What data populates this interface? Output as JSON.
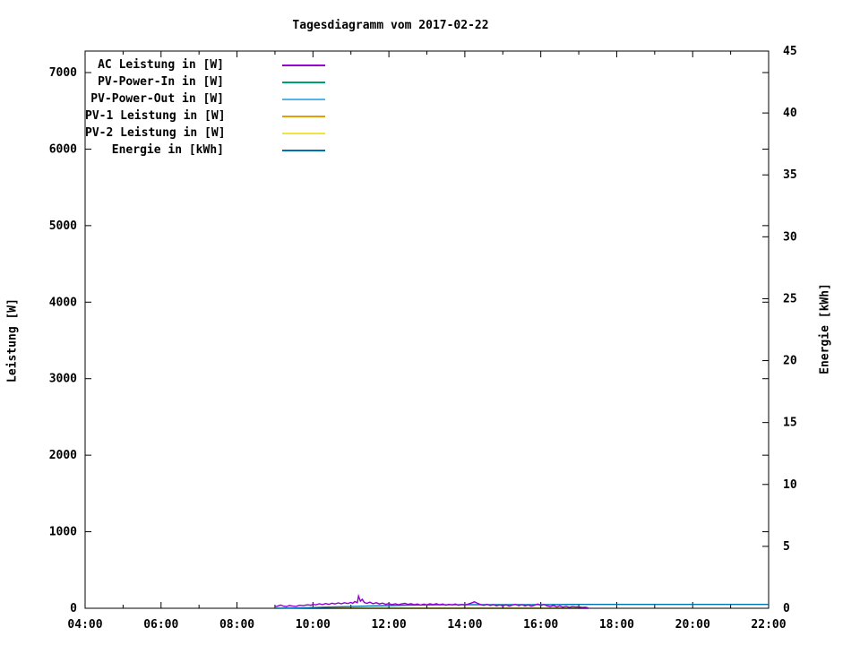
{
  "chart_data": {
    "type": "line",
    "title": "Tagesdiagramm vom 2017-02-22",
    "ylabel_left": "Leistung [W]",
    "ylabel_right": "Energie [kWh]",
    "background_color": "#ffffff",
    "axis_color": "#000000",
    "grid": "off",
    "legend_position": "top-left-inside",
    "x_axis": {
      "unit": "time-of-day",
      "start_hour": 4,
      "end_hour": 22,
      "major_tick_labels": [
        "04:00",
        "06:00",
        "08:00",
        "10:00",
        "12:00",
        "14:00",
        "16:00",
        "18:00",
        "20:00",
        "22:00"
      ],
      "major_tick_hours": [
        4,
        6,
        8,
        10,
        12,
        14,
        16,
        18,
        20,
        22
      ],
      "minor_tick_hours": [
        5,
        7,
        9,
        11,
        13,
        15,
        17,
        19,
        21
      ]
    },
    "y_left": {
      "label": "Leistung [W]",
      "min": 0,
      "max": 7280,
      "tick_values": [
        0,
        1000,
        2000,
        3000,
        4000,
        5000,
        6000,
        7000
      ]
    },
    "y_right": {
      "label": "Energie [kWh]",
      "min": 0,
      "max": 45,
      "tick_values": [
        0,
        5,
        10,
        15,
        20,
        25,
        30,
        35,
        40,
        45
      ]
    },
    "series": [
      {
        "name": "AC Leistung in [W]",
        "color": "#9400d3",
        "axis": "left",
        "points": [
          [
            9.0,
            18
          ],
          [
            9.08,
            30
          ],
          [
            9.15,
            42
          ],
          [
            9.22,
            28
          ],
          [
            9.3,
            22
          ],
          [
            9.38,
            36
          ],
          [
            9.45,
            30
          ],
          [
            9.55,
            24
          ],
          [
            9.65,
            40
          ],
          [
            9.75,
            34
          ],
          [
            9.85,
            46
          ],
          [
            9.95,
            40
          ],
          [
            10.0,
            52
          ],
          [
            10.08,
            44
          ],
          [
            10.17,
            58
          ],
          [
            10.25,
            48
          ],
          [
            10.33,
            62
          ],
          [
            10.42,
            52
          ],
          [
            10.5,
            66
          ],
          [
            10.58,
            56
          ],
          [
            10.67,
            70
          ],
          [
            10.75,
            58
          ],
          [
            10.83,
            72
          ],
          [
            10.92,
            62
          ],
          [
            11.0,
            76
          ],
          [
            11.05,
            64
          ],
          [
            11.1,
            88
          ],
          [
            11.17,
            72
          ],
          [
            11.2,
            160
          ],
          [
            11.25,
            92
          ],
          [
            11.3,
            118
          ],
          [
            11.35,
            76
          ],
          [
            11.42,
            64
          ],
          [
            11.5,
            80
          ],
          [
            11.58,
            60
          ],
          [
            11.67,
            72
          ],
          [
            11.75,
            56
          ],
          [
            11.83,
            68
          ],
          [
            11.92,
            52
          ],
          [
            12.0,
            62
          ],
          [
            12.08,
            48
          ],
          [
            12.17,
            58
          ],
          [
            12.25,
            46
          ],
          [
            12.33,
            56
          ],
          [
            12.42,
            64
          ],
          [
            12.5,
            50
          ],
          [
            12.58,
            60
          ],
          [
            12.67,
            46
          ],
          [
            12.75,
            56
          ],
          [
            12.83,
            42
          ],
          [
            12.92,
            54
          ],
          [
            13.0,
            44
          ],
          [
            13.08,
            58
          ],
          [
            13.17,
            48
          ],
          [
            13.25,
            60
          ],
          [
            13.33,
            46
          ],
          [
            13.42,
            56
          ],
          [
            13.5,
            40
          ],
          [
            13.58,
            52
          ],
          [
            13.67,
            44
          ],
          [
            13.75,
            56
          ],
          [
            13.83,
            40
          ],
          [
            13.92,
            50
          ],
          [
            14.0,
            42
          ],
          [
            14.08,
            54
          ],
          [
            14.17,
            68
          ],
          [
            14.25,
            84
          ],
          [
            14.33,
            66
          ],
          [
            14.42,
            48
          ],
          [
            14.5,
            38
          ],
          [
            14.58,
            52
          ],
          [
            14.67,
            36
          ],
          [
            14.75,
            48
          ],
          [
            14.83,
            32
          ],
          [
            14.92,
            44
          ],
          [
            15.0,
            30
          ],
          [
            15.08,
            46
          ],
          [
            15.17,
            28
          ],
          [
            15.25,
            42
          ],
          [
            15.33,
            52
          ],
          [
            15.42,
            34
          ],
          [
            15.5,
            48
          ],
          [
            15.58,
            30
          ],
          [
            15.67,
            44
          ],
          [
            15.75,
            26
          ],
          [
            15.83,
            40
          ],
          [
            15.92,
            56
          ],
          [
            16.0,
            36
          ],
          [
            16.08,
            50
          ],
          [
            16.17,
            32
          ],
          [
            16.25,
            22
          ],
          [
            16.33,
            38
          ],
          [
            16.42,
            18
          ],
          [
            16.5,
            30
          ],
          [
            16.58,
            14
          ],
          [
            16.67,
            26
          ],
          [
            16.75,
            12
          ],
          [
            16.83,
            22
          ],
          [
            16.92,
            16
          ],
          [
            17.0,
            20
          ],
          [
            17.08,
            10
          ],
          [
            17.17,
            14
          ],
          [
            17.25,
            6
          ]
        ]
      },
      {
        "name": "PV-Power-In in [W]",
        "color": "#009e73",
        "axis": "left",
        "points": [
          [
            9.0,
            0
          ],
          [
            17.25,
            0
          ]
        ]
      },
      {
        "name": "PV-Power-Out in [W]",
        "color": "#56b4e9",
        "axis": "left",
        "points": [
          [
            9.0,
            0
          ],
          [
            17.25,
            0
          ]
        ]
      },
      {
        "name": "PV-1 Leistung in [W]",
        "color": "#e69f00",
        "axis": "left",
        "points": [
          [
            9.0,
            0
          ],
          [
            17.25,
            0
          ]
        ]
      },
      {
        "name": "PV-2 Leistung in [W]",
        "color": "#f0e442",
        "axis": "left",
        "points": [
          [
            9.0,
            0
          ],
          [
            17.25,
            0
          ]
        ]
      },
      {
        "name": "Energie in [kWh]",
        "color": "#0072b2",
        "axis": "right",
        "points": [
          [
            9.0,
            0
          ],
          [
            9.5,
            0.02
          ],
          [
            10.0,
            0.06
          ],
          [
            10.5,
            0.1
          ],
          [
            11.0,
            0.14
          ],
          [
            11.5,
            0.19
          ],
          [
            12.0,
            0.22
          ],
          [
            12.5,
            0.25
          ],
          [
            13.0,
            0.27
          ],
          [
            13.5,
            0.28
          ],
          [
            14.0,
            0.29
          ],
          [
            15.0,
            0.3
          ],
          [
            16.0,
            0.3
          ],
          [
            17.0,
            0.31
          ],
          [
            17.3,
            0.31
          ],
          [
            22.0,
            0.31
          ]
        ]
      }
    ]
  }
}
